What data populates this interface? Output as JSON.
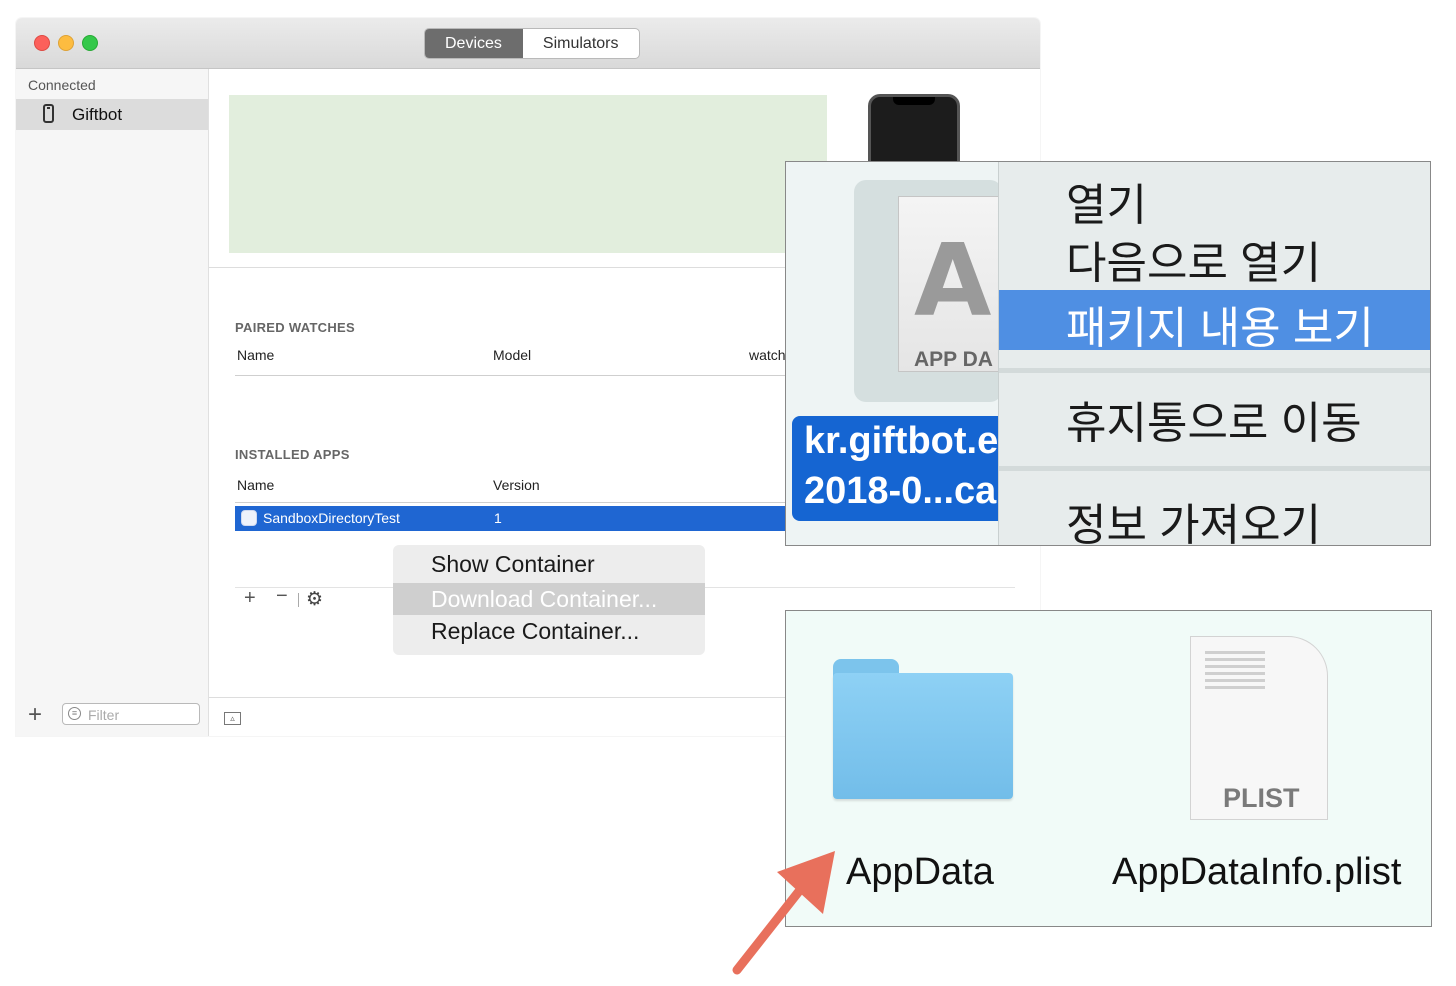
{
  "window": {
    "segmented": {
      "devices": "Devices",
      "simulators": "Simulators",
      "selected": "Devices"
    }
  },
  "sidebar": {
    "header": "Connected",
    "items": [
      {
        "label": "Giftbot",
        "icon": "iphone-icon"
      }
    ],
    "filter_placeholder": "Filter"
  },
  "paired_watches": {
    "title": "PAIRED WATCHES",
    "columns": [
      "Name",
      "Model",
      "watch"
    ]
  },
  "installed_apps": {
    "title": "INSTALLED APPS",
    "columns": [
      "Name",
      "Version"
    ],
    "rows": [
      {
        "name": "SandboxDirectoryTest",
        "version": "1",
        "selected": true
      }
    ]
  },
  "toolbar": {
    "add": "+",
    "remove": "−",
    "gear": "⚙"
  },
  "context_menu": {
    "items": [
      {
        "label": "Show Container"
      },
      {
        "label": "Download Container...",
        "highlighted": true
      },
      {
        "label": "Replace Container..."
      }
    ]
  },
  "finder_context": {
    "file_icon_label": "APP DA",
    "file_name_line1": "kr.giftbot.e",
    "file_name_line2": "2018-0...ca",
    "menu": [
      "열기",
      "다음으로 열기",
      "패키지 내용 보기",
      "휴지통으로 이동",
      "정보 가져오기"
    ],
    "highlighted": "패키지 내용 보기"
  },
  "finder_files": {
    "items": [
      {
        "name": "AppData",
        "icon": "folder-icon"
      },
      {
        "name": "AppDataInfo.plist",
        "icon": "plist-file-icon",
        "icon_label": "PLIST"
      }
    ]
  },
  "colors": {
    "selection_blue": "#1f66d2",
    "menu_highlight_blue": "#4f8fe3",
    "arrow": "#e8705c",
    "banner_green": "#e2eedd"
  }
}
